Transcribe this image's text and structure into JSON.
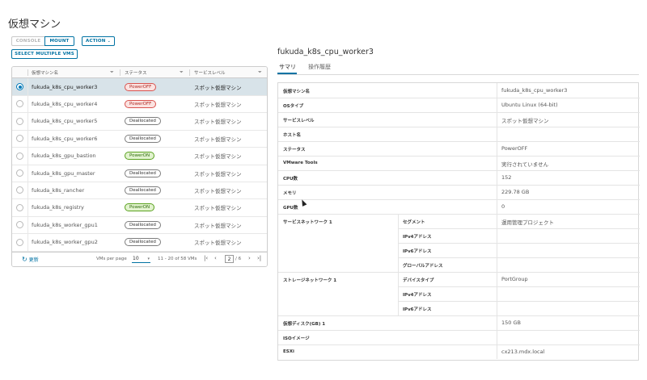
{
  "page": {
    "title": "仮想マシン"
  },
  "toolbar": {
    "console_label": "CONSOLE",
    "mount_label": "MOUNT",
    "action_label": "ACTION",
    "select_multiple_label": "SELECT MULTIPLE VMS"
  },
  "grid": {
    "columns": [
      "仮想マシン名",
      "ステータス",
      "サービスレベル"
    ],
    "rows": [
      {
        "name": "fukuda_k8s_cpu_worker3",
        "status": "PowerOFF",
        "status_kind": "off",
        "service": "スポット仮想マシン",
        "selected": true
      },
      {
        "name": "fukuda_k8s_cpu_worker4",
        "status": "PowerOFF",
        "status_kind": "off",
        "service": "スポット仮想マシン",
        "selected": false
      },
      {
        "name": "fukuda_k8s_cpu_worker5",
        "status": "Deallocated",
        "status_kind": "dealloc",
        "service": "スポット仮想マシン",
        "selected": false
      },
      {
        "name": "fukuda_k8s_cpu_worker6",
        "status": "Deallocated",
        "status_kind": "dealloc",
        "service": "スポット仮想マシン",
        "selected": false
      },
      {
        "name": "fukuda_k8s_gpu_bastion",
        "status": "PowerON",
        "status_kind": "on",
        "service": "スポット仮想マシン",
        "selected": false
      },
      {
        "name": "fukuda_k8s_gpu_master",
        "status": "Deallocated",
        "status_kind": "dealloc",
        "service": "スポット仮想マシン",
        "selected": false
      },
      {
        "name": "fukuda_k8s_rancher",
        "status": "Deallocated",
        "status_kind": "dealloc",
        "service": "スポット仮想マシン",
        "selected": false
      },
      {
        "name": "fukuda_k8s_registry",
        "status": "PowerON",
        "status_kind": "on",
        "service": "スポット仮想マシン",
        "selected": false
      },
      {
        "name": "fukuda_k8s_worker_gpu1",
        "status": "Deallocated",
        "status_kind": "dealloc",
        "service": "スポット仮想マシン",
        "selected": false
      },
      {
        "name": "fukuda_k8s_worker_gpu2",
        "status": "Deallocated",
        "status_kind": "dealloc",
        "service": "スポット仮想マシン",
        "selected": false
      }
    ],
    "footer": {
      "refresh_label": "更新",
      "vms_per_page_label": "VMs per page",
      "vms_per_page_value": "10",
      "range_text": "11 - 20 of 58 VMs",
      "current_page": "2",
      "total_pages": "/ 6"
    }
  },
  "detail": {
    "title": "fukuda_k8s_cpu_worker3",
    "tabs": [
      "サマリ",
      "操作履歴"
    ],
    "rows": [
      {
        "label": "仮想マシン名",
        "value": "fukuda_k8s_cpu_worker3"
      },
      {
        "label": "OSタイプ",
        "value": "Ubuntu Linux (64-bit)"
      },
      {
        "label": "サービスレベル",
        "value": "スポット仮想マシン"
      },
      {
        "label": "ホスト名",
        "value": ""
      },
      {
        "label": "ステータス",
        "value": "PowerOFF"
      },
      {
        "label": "VMware Tools",
        "value": "実行されていません"
      },
      {
        "label": "CPU数",
        "value": "152"
      },
      {
        "label": "メモリ",
        "value": "229.78 GB"
      },
      {
        "label": "GPU数",
        "value": "0"
      }
    ],
    "network": {
      "label": "サービスネットワーク 1",
      "rows": [
        {
          "label": "セグメント",
          "value": "運用管理プロジェクト"
        },
        {
          "label": "IPv4アドレス",
          "value": ""
        },
        {
          "label": "IPv6アドレス",
          "value": ""
        },
        {
          "label": "グローバルアドレス",
          "value": ""
        }
      ]
    },
    "storage_network": {
      "label": "ストレージネットワーク 1",
      "rows": [
        {
          "label": "デバイスタイプ",
          "value": "PortGroup"
        },
        {
          "label": "IPv4アドレス",
          "value": ""
        },
        {
          "label": "IPv6アドレス",
          "value": ""
        }
      ]
    },
    "tail_rows": [
      {
        "label": "仮想ディスク(GB) 1",
        "value": "150 GB"
      },
      {
        "label": "ISOイメージ",
        "value": ""
      },
      {
        "label": "ESXi",
        "value": "cx213.mdx.local"
      }
    ]
  }
}
